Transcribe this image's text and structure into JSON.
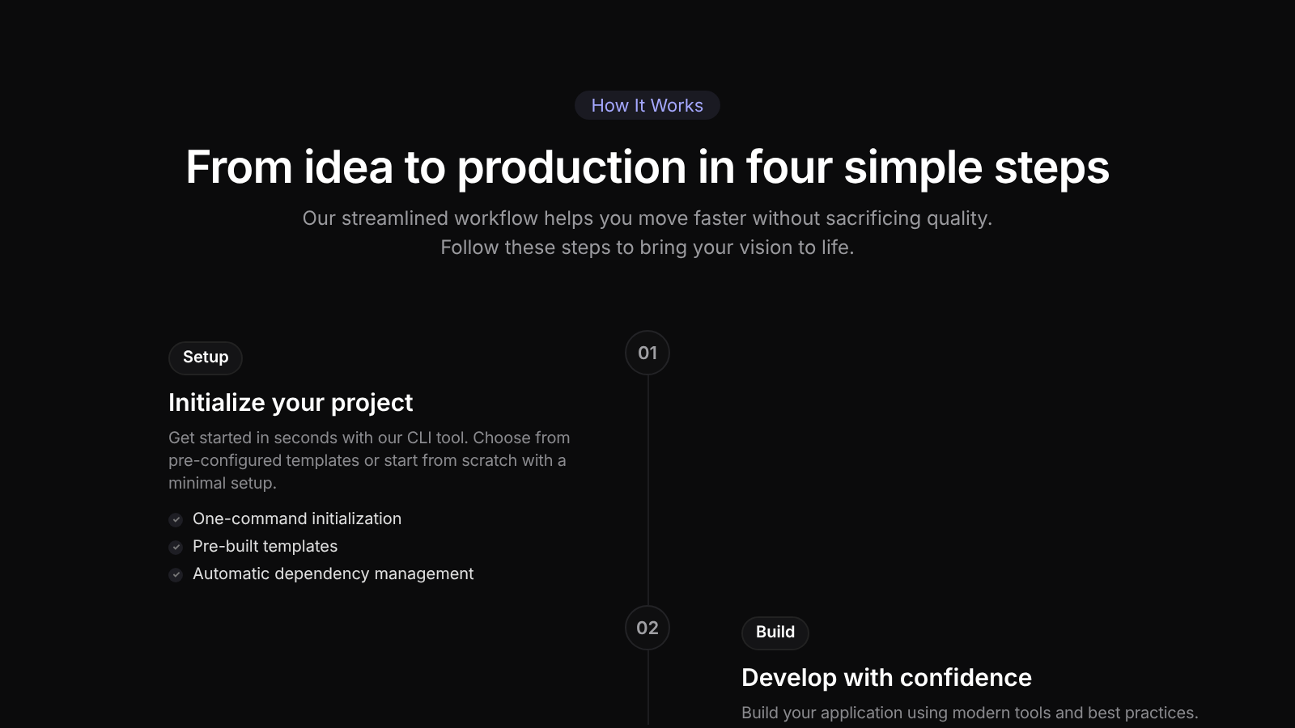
{
  "section_badge": "How It Works",
  "title": "From idea to production in four simple steps",
  "subtitle": [
    "Our streamlined workflow helps you move faster without sacrificing quality.",
    "Follow these steps to bring your vision to life."
  ],
  "steps": [
    {
      "number": "01",
      "tag": "Setup",
      "heading": "Initialize your project",
      "description": "Get started in seconds with our CLI tool. Choose from pre-configured templates or start from scratch with a minimal setup.",
      "features": [
        "One-command initialization",
        "Pre-built templates",
        "Automatic dependency management"
      ]
    },
    {
      "number": "02",
      "tag": "Build",
      "heading": "Develop with confidence",
      "description": "Build your application using modern tools and best practices."
    }
  ]
}
